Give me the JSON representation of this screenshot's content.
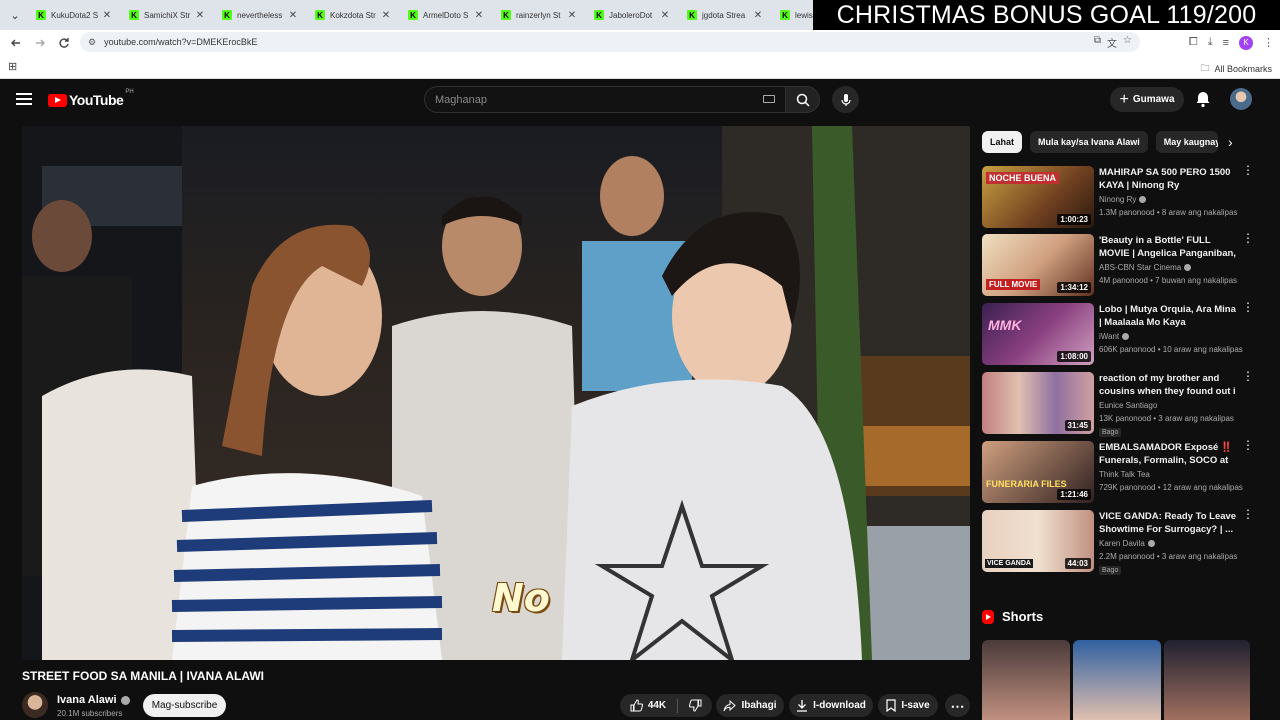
{
  "browser": {
    "tabs": [
      {
        "label": "KukuDota2 S"
      },
      {
        "label": "SamichiX Str"
      },
      {
        "label": "nevertheless"
      },
      {
        "label": "Kokzdota Str"
      },
      {
        "label": "ArmelDoto S"
      },
      {
        "label": "rainzerlyn St"
      },
      {
        "label": "JaboleroDot"
      },
      {
        "label": "jgdota Strea"
      },
      {
        "label": "lewisd"
      }
    ],
    "tab_favicon": "K",
    "url": "youtube.com/watch?v=DMEKErocBkE",
    "profile_initial": "K",
    "all_bookmarks": "All Bookmarks"
  },
  "overlay": {
    "goal_text": "CHRISTMAS BONUS GOAL 119/200"
  },
  "youtube": {
    "logo_text": "YouTube",
    "country": "PH",
    "search_placeholder": "Maghanap",
    "create_label": "Gumawa"
  },
  "video": {
    "caption": "No",
    "title": "STREET FOOD SA MANILA | IVANA ALAWI",
    "channel": "Ivana Alawi",
    "subscribers": "20.1M subscribers",
    "subscribe_label": "Mag-subscribe",
    "likes": "44K",
    "share_label": "Ibahagi",
    "download_label": "I-download",
    "save_label": "I-save"
  },
  "chips": [
    {
      "label": "Lahat"
    },
    {
      "label": "Mula kay/sa Ivana Alawi"
    },
    {
      "label": "May kaugnay"
    }
  ],
  "recommendations": [
    {
      "title": "MAHIRAP SA 500 PERO 1500 KAYA | Ninong Ry",
      "channel": "Ninong Ry",
      "meta": "1.3M panonood • 8 araw ang nakalipas",
      "duration": "1:00:23",
      "thumb_text": "NOCHE BUENA",
      "badge": ""
    },
    {
      "title": "'Beauty in a Bottle' FULL MOVIE | Angelica Panganiban, Assunt...",
      "channel": "ABS-CBN Star Cinema",
      "meta": "4M panonood • 7 buwan ang nakalipas",
      "duration": "1:34:12",
      "thumb_text": "FULL MOVIE",
      "badge": ""
    },
    {
      "title": "Lobo | Mutya Orquia, Ara Mina | Maalaala Mo Kaya",
      "channel": "iWant",
      "meta": "606K panonood • 10 araw ang nakalipas",
      "duration": "1:08:00",
      "thumb_text": "MMK",
      "badge": ""
    },
    {
      "title": "reaction of my brother and cousins when they found out i ...",
      "channel": "Eunice Santiago",
      "meta": "13K panonood • 3 araw ang nakalipas",
      "duration": "31:45",
      "thumb_text": "",
      "badge": "Bago"
    },
    {
      "title": "EMBALSAMADOR Exposé ‼️ Funerals, Formalin, SOCO at ...",
      "channel": "Think Talk Tea",
      "meta": "729K panonood • 12 araw ang nakalipas",
      "duration": "1:21:46",
      "thumb_text": "FUNERARIA FILES",
      "badge": ""
    },
    {
      "title": "VICE GANDA: Ready To Leave Showtime For Surrogacy? | ...",
      "channel": "Karen Davila",
      "meta": "2.2M panonood • 3 araw ang nakalipas",
      "duration": "44:03",
      "thumb_text": "VICE GANDA",
      "badge": "Bago"
    }
  ],
  "shorts": {
    "label": "Shorts"
  }
}
